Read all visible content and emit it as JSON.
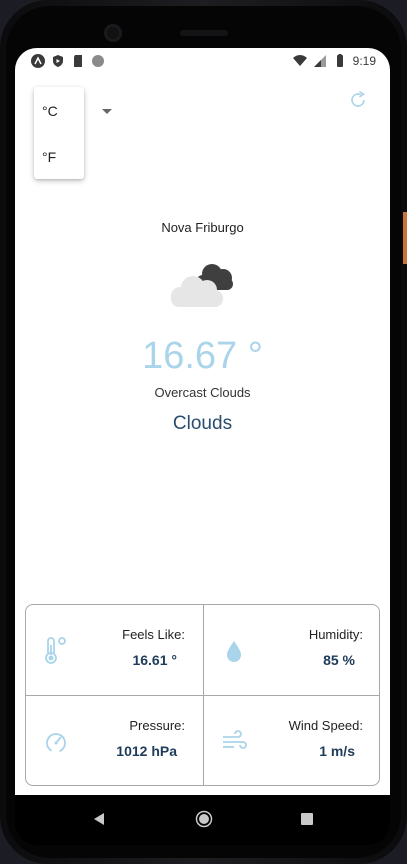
{
  "status_bar": {
    "time": "9:19",
    "icons_left": [
      "app-a-icon",
      "shield-icon",
      "sd-card-icon",
      "circle-icon"
    ],
    "icons_right": [
      "wifi-icon",
      "signal-icon",
      "battery-icon"
    ]
  },
  "unit_menu": {
    "options": [
      "°C",
      "°F"
    ]
  },
  "weather": {
    "city": "Nova Friburgo",
    "temperature": "16.67 °",
    "description": "Overcast Clouds",
    "main": "Clouds"
  },
  "details": {
    "feels_like": {
      "label": "Feels Like:",
      "value": "16.61 °"
    },
    "humidity": {
      "label": "Humidity:",
      "value": "85 %"
    },
    "pressure": {
      "label": "Pressure:",
      "value": "1012 hPa"
    },
    "wind_speed": {
      "label": "Wind Speed:",
      "value": "1 m/s"
    }
  },
  "colors": {
    "accent": "#a9d4e9",
    "primary_text": "#2a4d6e",
    "value_text": "#1f3b5a",
    "border": "#a8a8a8"
  }
}
